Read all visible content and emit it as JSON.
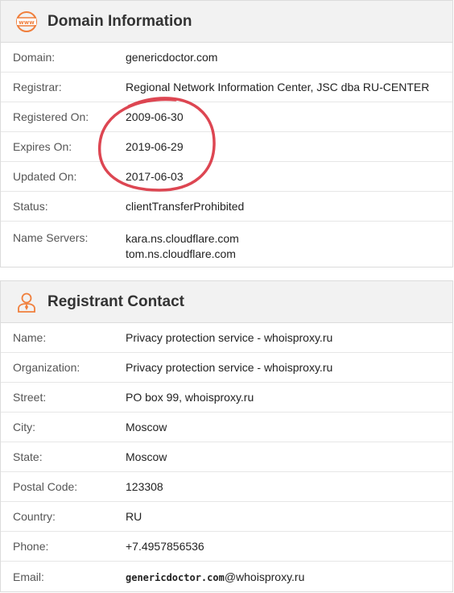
{
  "domain_section": {
    "title": "Domain Information",
    "icon": "www-globe-icon",
    "rows": [
      {
        "label": "Domain:",
        "value": "genericdoctor.com"
      },
      {
        "label": "Registrar:",
        "value": "Regional Network Information Center, JSC dba RU-CENTER"
      },
      {
        "label": "Registered On:",
        "value": "2009-06-30"
      },
      {
        "label": "Expires On:",
        "value": "2019-06-29"
      },
      {
        "label": "Updated On:",
        "value": "2017-06-03"
      },
      {
        "label": "Status:",
        "value": "clientTransferProhibited"
      }
    ],
    "name_servers_label": "Name Servers:",
    "name_servers": [
      "kara.ns.cloudflare.com",
      "tom.ns.cloudflare.com"
    ]
  },
  "registrant_section": {
    "title": "Registrant Contact",
    "icon": "person-icon",
    "rows": [
      {
        "label": "Name:",
        "value": "Privacy protection service - whoisproxy.ru"
      },
      {
        "label": "Organization:",
        "value": "Privacy protection service - whoisproxy.ru"
      },
      {
        "label": "Street:",
        "value": "PO box 99, whoisproxy.ru"
      },
      {
        "label": "City:",
        "value": "Moscow"
      },
      {
        "label": "State:",
        "value": "Moscow"
      },
      {
        "label": "Postal Code:",
        "value": "123308"
      },
      {
        "label": "Country:",
        "value": "RU"
      },
      {
        "label": "Phone:",
        "value": "+7.4957856536"
      }
    ],
    "email_label": "Email:",
    "email_user": "genericdoctor.com",
    "email_domain": "@whoisproxy.ru"
  },
  "colors": {
    "accent_icon": "#f07f3c",
    "annotation_circle": "#d9323f"
  }
}
